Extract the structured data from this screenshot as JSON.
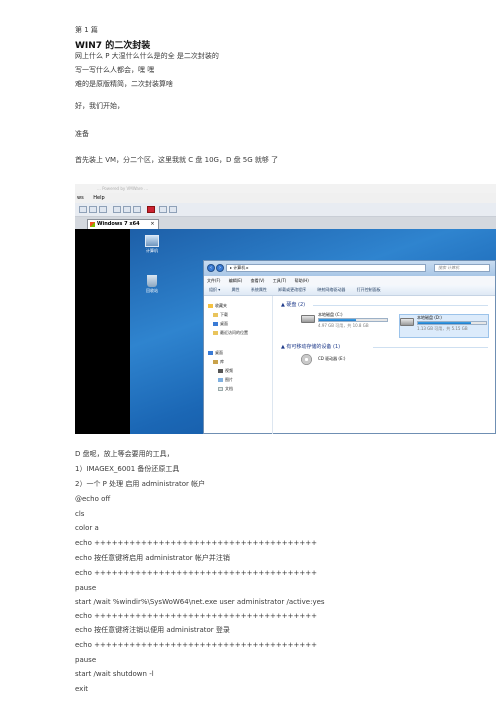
{
  "header": {
    "page_label": "第 1 篇",
    "title": "WIN7 的二次封装"
  },
  "intro": [
    "网上什么 P 大湿什么什么是的全  是二次封装的",
    "写一写什么人都会，嘿  嘿",
    "难的是原版精简，二次封装算啥",
    "好，我们开始，",
    "准备",
    "首先装上 VM，分二个区，这里我就 C 盘 10G，D 盘 5G 就够  了"
  ],
  "screenshot": {
    "caption": "...  Powered by VMWare ...",
    "vm_menu": [
      "ws",
      "Help"
    ],
    "vm_tab_label": "Windows 7 x64",
    "desktop_icons": [
      "计算机",
      "回收站"
    ],
    "explorer": {
      "address": "▸ 计算机 ▸",
      "search_placeholder": "搜索 计算机",
      "menu": [
        "文件(F)",
        "编辑(E)",
        "查看(V)",
        "工具(T)",
        "帮助(H)"
      ],
      "commands": [
        "组织 ▾",
        "属性",
        "系统属性",
        "卸载或更改程序",
        "映射网络驱动器",
        "打开控制面板"
      ],
      "nav_items": [
        {
          "label": "收藏夹",
          "icon": "star-icon"
        },
        {
          "label": "下载",
          "icon": "folder-icon"
        },
        {
          "label": "桌面",
          "icon": "desktop-icon"
        },
        {
          "label": "最近访问的位置",
          "icon": "folder-icon"
        },
        {
          "label": "桌面",
          "icon": "desktop-icon"
        },
        {
          "label": "库",
          "icon": "library-icon"
        },
        {
          "label": "视频",
          "icon": "video-icon"
        },
        {
          "label": "图片",
          "icon": "picture-icon"
        },
        {
          "label": "文档",
          "icon": "document-icon"
        }
      ],
      "group_hdd": "▲ 硬盘 (2)",
      "group_removable": "▲ 有可移动存储的设备 (1)",
      "drives": [
        {
          "name": "本地磁盘 (C:)",
          "size": "4.97 GB 可用，共 10.8 GB",
          "used_fraction": 0.54
        },
        {
          "name": "本地磁盘 (D:)",
          "size": "1.13 GB 可用，共 5.15 GB",
          "used_fraction": 0.78
        }
      ],
      "cd_drive": "CD 驱动器 (E:)"
    }
  },
  "body": [
    "D 盘呢，放上等会要用的工具，",
    "1）IMAGEX_6001 备份还原工具",
    "2）一个 P 处理 启用 administrator 帐户",
    "@echo off",
    "cls",
    "color a",
    "echo ++++++++++++++++++++++++++++++++++++++",
    "echo  按任意键将启用 administrator 帐户并注销",
    "echo ++++++++++++++++++++++++++++++++++++++",
    "pause",
    "start /wait %windir%\\SysWoW64\\net.exe user administrator /active:yes",
    "echo ++++++++++++++++++++++++++++++++++++++",
    "echo  按任意键将注销以便用 administrator 登录",
    "echo ++++++++++++++++++++++++++++++++++++++",
    "pause",
    "start /wait shutdown -l",
    "exit"
  ],
  "colors": {
    "desktop_blue": "#2f84cf",
    "accent": "#1e78c8"
  }
}
